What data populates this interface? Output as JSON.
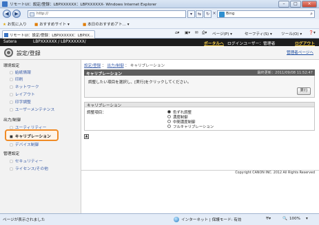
{
  "browser": {
    "window_title": "リモートUI：設定/登録：LBPXXXXXX：LBPXXXXXX- Windows Internet Explorer",
    "address_value": "http://",
    "search_value": "Bing",
    "favorites": [
      "お気に入り",
      "おすすめサイト ▾",
      "本日のおすすめアト… ▾"
    ],
    "tab_title": "リモートUI：設定/登録：LBPXXXXXX：LBPXX…",
    "commands": [
      "ページ(P) ▾",
      "セーフティ(S) ▾",
      "ツール(O) ▾"
    ],
    "status_text": "ページが表示されました",
    "zone_text": "インターネット | 保護モード: 有効",
    "zoom": "100%"
  },
  "header": {
    "brand": "Satera",
    "device": "LBPXXXXXX / LBPXXXXXX/",
    "portal_link": "ポータルへ",
    "login_user": "ログインユーザー：管理者",
    "logout_link": "ログアウト"
  },
  "band": {
    "title": "設定/登録",
    "to_portal": "管理者ページへ"
  },
  "sidebar": {
    "sections": [
      {
        "label": "環境設定",
        "items": [
          "給紙情報",
          "印刷",
          "ネットワーク",
          "レイアウト",
          "印字調整",
          "ユーザーメンテナンス"
        ]
      },
      {
        "label": "出力/制御",
        "items": [
          "ユーティリティー",
          "キャリブレーション",
          "デバイス制御"
        ]
      },
      {
        "label": "管理設定",
        "items": [
          "セキュリティー",
          "ライセンス/その他"
        ]
      }
    ],
    "selected": "キャリブレーション"
  },
  "main": {
    "breadcrumb": {
      "a": "設定/登録",
      "b": "出力/制御",
      "c": "キャリブレーション"
    },
    "section_title": "キャリブレーション",
    "last_update": "最終更新：2011/09/08 11:52:47",
    "instruction": "調整したい項目を選択し、[実行]をクリックしてください。",
    "exec_label": "実行",
    "sub_title": "キャリブレーション",
    "adjust_label": "調整項目：",
    "options": [
      "色ずれ調整",
      "濃度制御",
      "中間濃度制御",
      "フルキャリブレーション"
    ],
    "selected_option": "色ずれ調整",
    "copyright": "Copyright CANON INC. 2012 All Rights Reserved"
  }
}
